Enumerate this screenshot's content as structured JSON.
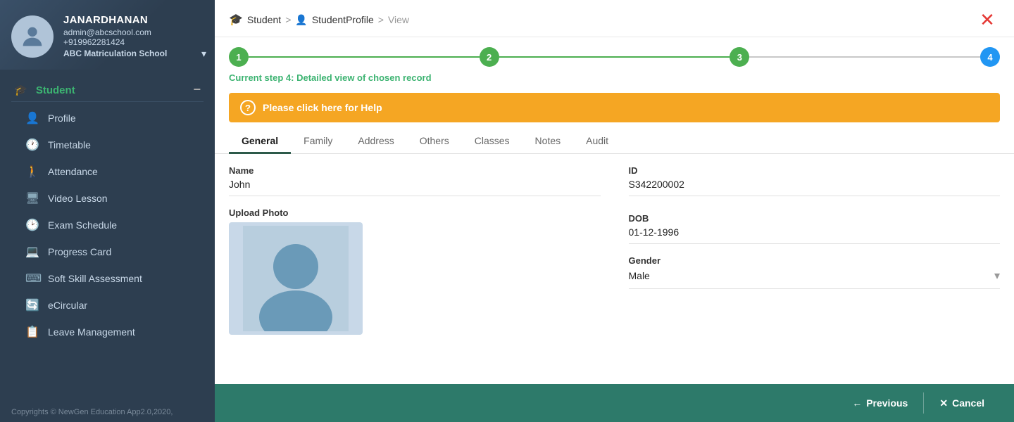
{
  "sidebar": {
    "user": {
      "name": "JANARDHANAN",
      "email": "admin@abcschool.com",
      "phone": "+919962281424",
      "school": "ABC Matriculation School"
    },
    "section_label": "Student",
    "items": [
      {
        "id": "profile",
        "label": "Profile",
        "icon": "👤"
      },
      {
        "id": "timetable",
        "label": "Timetable",
        "icon": "🕐"
      },
      {
        "id": "attendance",
        "label": "Attendance",
        "icon": "🚶"
      },
      {
        "id": "video-lesson",
        "label": "Video Lesson",
        "icon": "🖥"
      },
      {
        "id": "exam-schedule",
        "label": "Exam Schedule",
        "icon": "🕑"
      },
      {
        "id": "progress-card",
        "label": "Progress Card",
        "icon": "💻"
      },
      {
        "id": "soft-skill",
        "label": "Soft Skill Assessment",
        "icon": "⌨"
      },
      {
        "id": "ecircular",
        "label": "eCircular",
        "icon": "🔄"
      },
      {
        "id": "leave-management",
        "label": "Leave Management",
        "icon": "📋"
      }
    ],
    "footer": "Copyrights © NewGen Education App2.0,2020,"
  },
  "breadcrumb": {
    "student_label": "Student",
    "profile_label": "StudentProfile",
    "view_label": "View",
    "sep": ">"
  },
  "stepper": {
    "steps": [
      {
        "num": "1",
        "color": "green"
      },
      {
        "num": "2",
        "color": "green"
      },
      {
        "num": "3",
        "color": "green"
      },
      {
        "num": "4",
        "color": "blue"
      }
    ],
    "current_step_text": "Current step 4: Detailed view of chosen record"
  },
  "help_bar": {
    "text": "Please click here for Help"
  },
  "tabs": [
    {
      "id": "general",
      "label": "General",
      "active": true
    },
    {
      "id": "family",
      "label": "Family",
      "active": false
    },
    {
      "id": "address",
      "label": "Address",
      "active": false
    },
    {
      "id": "others",
      "label": "Others",
      "active": false
    },
    {
      "id": "classes",
      "label": "Classes",
      "active": false
    },
    {
      "id": "notes",
      "label": "Notes",
      "active": false
    },
    {
      "id": "audit",
      "label": "Audit",
      "active": false
    }
  ],
  "form": {
    "name_label": "Name",
    "name_value": "John",
    "id_label": "ID",
    "id_value": "S342200002",
    "upload_label": "Upload Photo",
    "dob_label": "DOB",
    "dob_value": "01-12-1996",
    "gender_label": "Gender",
    "gender_value": "Male"
  },
  "bottom": {
    "previous_label": "Previous",
    "cancel_label": "Cancel"
  }
}
